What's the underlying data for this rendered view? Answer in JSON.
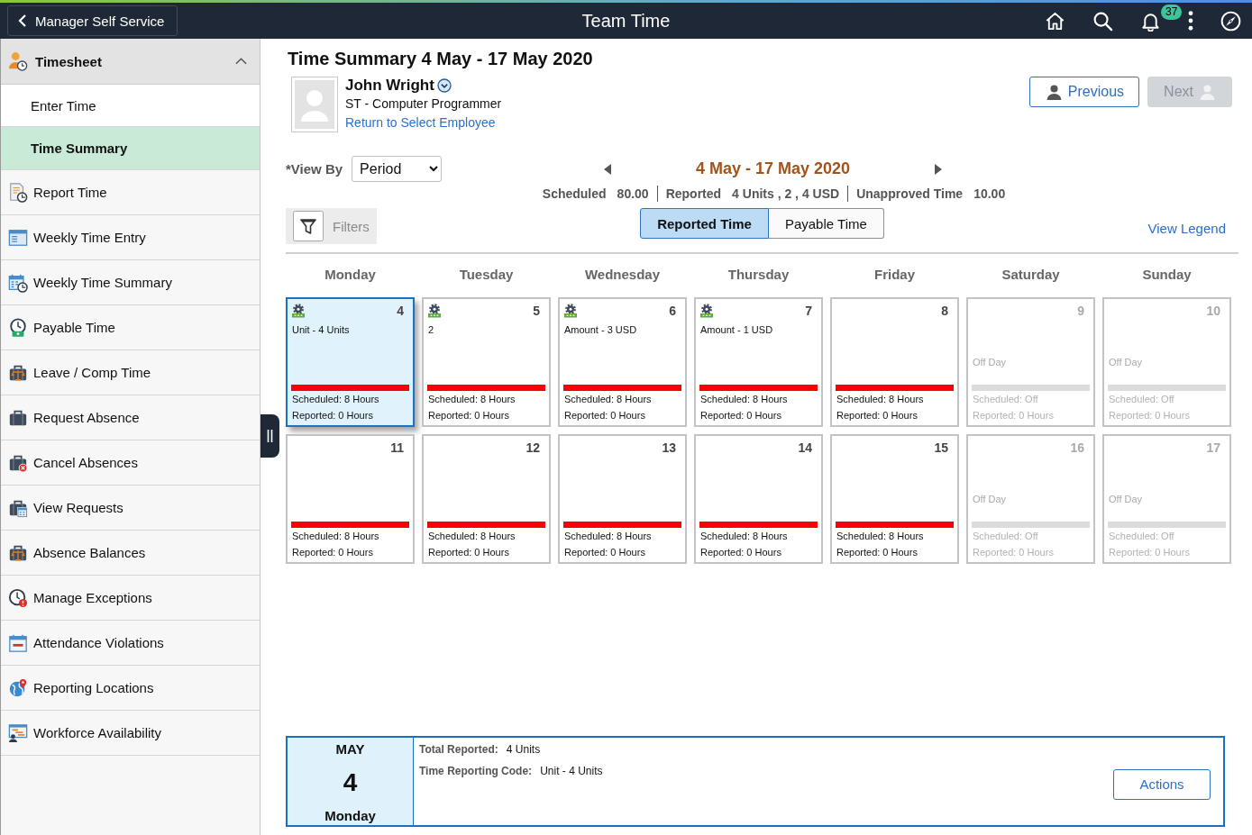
{
  "header": {
    "back_button": "Manager Self Service",
    "title": "Team Time",
    "notifications": "37"
  },
  "sidebar": {
    "group": {
      "label": "Timesheet",
      "expanded": true
    },
    "items": [
      {
        "label": "Enter Time",
        "kind": "page",
        "selected": false
      },
      {
        "label": "Time Summary",
        "kind": "page",
        "selected": true
      },
      {
        "label": "Report Time",
        "kind": "document",
        "selected": false
      },
      {
        "label": "Weekly Time Entry",
        "kind": "window",
        "selected": false
      },
      {
        "label": "Weekly Time Summary",
        "kind": "calendar",
        "selected": false
      },
      {
        "label": "Payable Time",
        "kind": "clock",
        "selected": false
      },
      {
        "label": "Leave / Comp Time",
        "kind": "scales",
        "selected": false
      },
      {
        "label": "Request Absence",
        "kind": "briefcase",
        "selected": false
      },
      {
        "label": "Cancel Absences",
        "kind": "cancel",
        "selected": false
      },
      {
        "label": "View Requests",
        "kind": "schedule",
        "selected": false
      },
      {
        "label": "Absence Balances",
        "kind": "scales",
        "selected": false
      },
      {
        "label": "Manage Exceptions",
        "kind": "alert",
        "selected": false
      },
      {
        "label": "Attendance Violations",
        "kind": "planner",
        "selected": false
      },
      {
        "label": "Reporting Locations",
        "kind": "globe",
        "selected": false
      },
      {
        "label": "Workforce Availability",
        "kind": "gantt",
        "selected": false
      }
    ]
  },
  "page": {
    "title": "Time Summary 4 May - 17 May 2020",
    "employee": {
      "name": "John Wright",
      "job": "ST - Computer Programmer",
      "link": "Return to Select Employee"
    },
    "navigation": [
      {
        "label": "Previous",
        "kind": "previous",
        "disabled": false
      },
      {
        "label": "Next",
        "kind": "next",
        "disabled": true
      }
    ],
    "view_by": {
      "label": "*View By",
      "value": "Period"
    },
    "period": "4 May - 17 May 2020",
    "totals": [
      {
        "label": "Scheduled",
        "value": "80.00"
      },
      {
        "label": "Reported",
        "value": "4 Units , 2 , 4 USD"
      },
      {
        "label": "Unapproved Time",
        "value": "10.00"
      }
    ],
    "filters": "Filters",
    "view_toggle": [
      {
        "label": "Reported Time",
        "selected": true
      },
      {
        "label": "Payable Time",
        "selected": false
      }
    ],
    "legend_link": "View Legend",
    "weekdays": [
      "Monday",
      "Tuesday",
      "Wednesday",
      "Thursday",
      "Friday",
      "Saturday",
      "Sunday"
    ],
    "days": [
      {
        "day": "4",
        "kind": "work",
        "selected": true,
        "entry": true,
        "detail": "Unit - 4 Units",
        "scheduled": "Scheduled: 8 Hours",
        "reported": "Reported: 0 Hours"
      },
      {
        "day": "5",
        "kind": "work",
        "selected": false,
        "entry": true,
        "detail": "2",
        "scheduled": "Scheduled: 8 Hours",
        "reported": "Reported: 0 Hours"
      },
      {
        "day": "6",
        "kind": "work",
        "selected": false,
        "entry": true,
        "detail": "Amount - 3 USD",
        "scheduled": "Scheduled: 8 Hours",
        "reported": "Reported: 0 Hours"
      },
      {
        "day": "7",
        "kind": "work",
        "selected": false,
        "entry": true,
        "detail": "Amount - 1 USD",
        "scheduled": "Scheduled: 8 Hours",
        "reported": "Reported: 0 Hours"
      },
      {
        "day": "8",
        "kind": "work",
        "selected": false,
        "entry": false,
        "scheduled": "Scheduled: 8 Hours",
        "reported": "Reported: 0 Hours"
      },
      {
        "day": "9",
        "kind": "off",
        "selected": false,
        "entry": false,
        "detail": "Off Day",
        "scheduled": "Scheduled: Off",
        "reported": "Reported: 0 Hours"
      },
      {
        "day": "10",
        "kind": "off",
        "selected": false,
        "entry": false,
        "detail": "Off Day",
        "scheduled": "Scheduled: Off",
        "reported": "Reported: 0 Hours"
      },
      {
        "day": "11",
        "kind": "work",
        "selected": false,
        "entry": false,
        "scheduled": "Scheduled: 8 Hours",
        "reported": "Reported: 0 Hours"
      },
      {
        "day": "12",
        "kind": "work",
        "selected": false,
        "entry": false,
        "scheduled": "Scheduled: 8 Hours",
        "reported": "Reported: 0 Hours"
      },
      {
        "day": "13",
        "kind": "work",
        "selected": false,
        "entry": false,
        "scheduled": "Scheduled: 8 Hours",
        "reported": "Reported: 0 Hours"
      },
      {
        "day": "14",
        "kind": "work",
        "selected": false,
        "entry": false,
        "scheduled": "Scheduled: 8 Hours",
        "reported": "Reported: 0 Hours"
      },
      {
        "day": "15",
        "kind": "work",
        "selected": false,
        "entry": false,
        "scheduled": "Scheduled: 8 Hours",
        "reported": "Reported: 0 Hours"
      },
      {
        "day": "16",
        "kind": "off",
        "selected": false,
        "entry": false,
        "detail": "Off Day",
        "scheduled": "Scheduled: Off",
        "reported": "Reported: 0 Hours"
      },
      {
        "day": "17",
        "kind": "off",
        "selected": false,
        "entry": false,
        "detail": "Off Day",
        "scheduled": "Scheduled: Off",
        "reported": "Reported: 0 Hours"
      }
    ],
    "detail": {
      "month": "MAY",
      "day": "4",
      "weekday": "Monday",
      "fields": [
        {
          "label": "Total Reported:",
          "value": "4 Units"
        },
        {
          "label": "Time Reporting Code:",
          "value": "Unit - 4 Units"
        }
      ],
      "action": "Actions"
    }
  }
}
